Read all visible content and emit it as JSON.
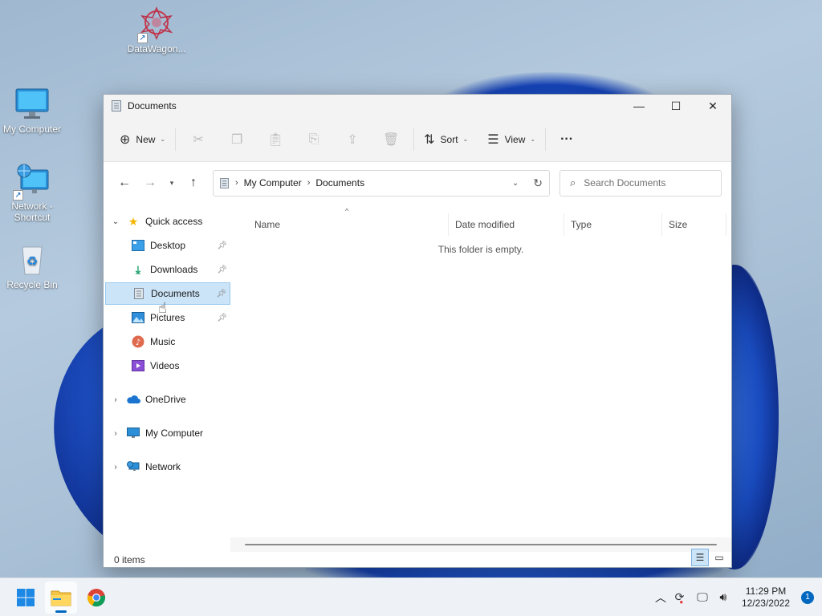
{
  "desktop": {
    "icons": [
      {
        "label": "DataWagon..."
      },
      {
        "label": "My Computer"
      },
      {
        "label": "Network - Shortcut"
      },
      {
        "label": "Recycle Bin"
      }
    ]
  },
  "window": {
    "title": "Documents",
    "controls": {
      "minimize": "—",
      "maximize": "☐",
      "close": "✕"
    }
  },
  "toolbar": {
    "new_label": "New",
    "sort_label": "Sort",
    "view_label": "View",
    "more_label": "···"
  },
  "address": {
    "crumbs": [
      "My Computer",
      "Documents"
    ]
  },
  "search": {
    "placeholder": "Search Documents"
  },
  "sidebar": {
    "quick_access": "Quick access",
    "items": [
      {
        "label": "Desktop",
        "pinned": true
      },
      {
        "label": "Downloads",
        "pinned": true
      },
      {
        "label": "Documents",
        "pinned": true,
        "selected": true
      },
      {
        "label": "Pictures",
        "pinned": true
      },
      {
        "label": "Music"
      },
      {
        "label": "Videos"
      }
    ],
    "roots": [
      {
        "label": "OneDrive"
      },
      {
        "label": "My Computer"
      },
      {
        "label": "Network"
      }
    ]
  },
  "columns": [
    "Name",
    "Date modified",
    "Type",
    "Size"
  ],
  "content": {
    "empty_message": "This folder is empty."
  },
  "status": {
    "items_count": "0 items"
  },
  "taskbar": {
    "time": "11:29 PM",
    "date": "12/23/2022",
    "notification_count": "1"
  },
  "colors": {
    "accent": "#0067c0",
    "selection": "#cce4f7",
    "wallpaper_blue": "#1d4fc4"
  }
}
